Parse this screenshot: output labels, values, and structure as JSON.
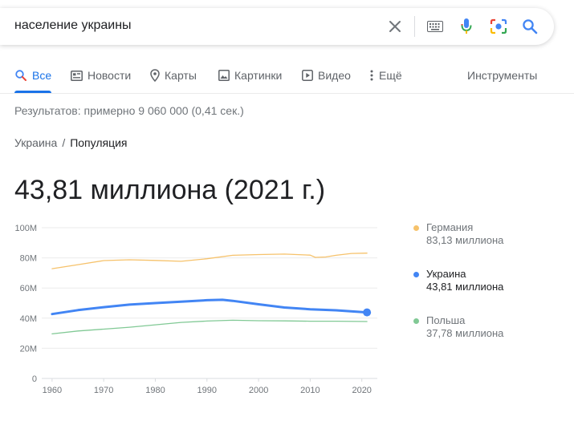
{
  "search": {
    "query": "население украины"
  },
  "tabs": [
    {
      "label": "Все",
      "icon": "search-icon",
      "active": true
    },
    {
      "label": "Новости",
      "icon": "news-icon"
    },
    {
      "label": "Карты",
      "icon": "map-pin-icon"
    },
    {
      "label": "Картинки",
      "icon": "image-icon"
    },
    {
      "label": "Видео",
      "icon": "video-icon"
    },
    {
      "label": "Ещё",
      "icon": "more-vert-icon"
    }
  ],
  "tools_label": "Инструменты",
  "result_stats": "Результатов: примерно 9 060 000 (0,41 сек.)",
  "breadcrumb": {
    "root": "Украина",
    "separator": "/",
    "current": "Популяция"
  },
  "answer": "43,81 миллиона (2021 г.)",
  "colors": {
    "accent": "#1a73e8",
    "germany": "#f6c26b",
    "ukraine": "#4285f4",
    "poland": "#81c995"
  },
  "legend": [
    {
      "name": "Германия",
      "value": "83,13 миллиона",
      "color": "#f6c26b"
    },
    {
      "name": "Украина",
      "value": "43,81 миллиона",
      "color": "#4285f4",
      "active": true
    },
    {
      "name": "Польша",
      "value": "37,78 миллиона",
      "color": "#81c995"
    }
  ],
  "chart_data": {
    "type": "line",
    "ylim": [
      0,
      100
    ],
    "xlim": [
      1960,
      2021
    ],
    "y_ticks": [
      "0",
      "20M",
      "40M",
      "60M",
      "80M",
      "100M"
    ],
    "x_ticks": [
      "1960",
      "1970",
      "1980",
      "1990",
      "2000",
      "2010",
      "2020"
    ],
    "grid": true,
    "legend_position": "right",
    "series": [
      {
        "name": "Германия",
        "color": "#f6c26b",
        "x": [
          1960,
          1965,
          1970,
          1975,
          1980,
          1985,
          1990,
          1995,
          2000,
          2005,
          2010,
          2011,
          2013,
          2015,
          2018,
          2021
        ],
        "values": [
          72.8,
          75.5,
          78.2,
          78.7,
          78.3,
          77.7,
          79.4,
          81.7,
          82.2,
          82.5,
          81.8,
          80.3,
          80.6,
          81.7,
          82.9,
          83.13
        ]
      },
      {
        "name": "Украина",
        "color": "#4285f4",
        "x": [
          1960,
          1965,
          1970,
          1975,
          1980,
          1985,
          1990,
          1993,
          1995,
          2000,
          2005,
          2010,
          2015,
          2021
        ],
        "values": [
          42.7,
          45.3,
          47.3,
          49.0,
          50.0,
          50.9,
          51.9,
          52.2,
          51.5,
          49.2,
          47.1,
          45.9,
          45.2,
          43.81
        ]
      },
      {
        "name": "Польша",
        "color": "#81c995",
        "x": [
          1960,
          1965,
          1970,
          1975,
          1980,
          1985,
          1990,
          1995,
          2000,
          2005,
          2010,
          2015,
          2021
        ],
        "values": [
          29.6,
          31.5,
          32.7,
          34.0,
          35.6,
          37.2,
          38.1,
          38.6,
          38.3,
          38.2,
          38.0,
          38.0,
          37.78
        ]
      }
    ]
  }
}
